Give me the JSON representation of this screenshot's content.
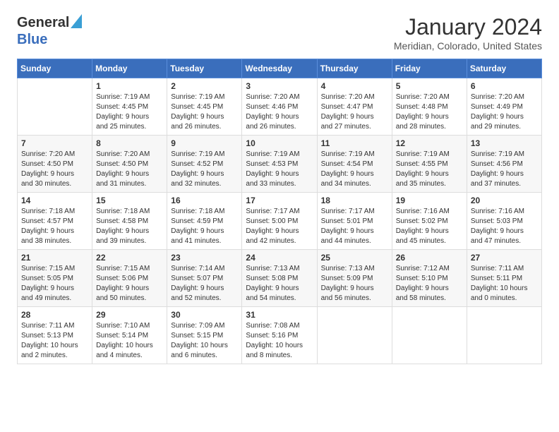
{
  "header": {
    "logo_general": "General",
    "logo_blue": "Blue",
    "title": "January 2024",
    "subtitle": "Meridian, Colorado, United States"
  },
  "days_of_week": [
    "Sunday",
    "Monday",
    "Tuesday",
    "Wednesday",
    "Thursday",
    "Friday",
    "Saturday"
  ],
  "weeks": [
    [
      {
        "day": "",
        "info": ""
      },
      {
        "day": "1",
        "info": "Sunrise: 7:19 AM\nSunset: 4:45 PM\nDaylight: 9 hours\nand 25 minutes."
      },
      {
        "day": "2",
        "info": "Sunrise: 7:19 AM\nSunset: 4:45 PM\nDaylight: 9 hours\nand 26 minutes."
      },
      {
        "day": "3",
        "info": "Sunrise: 7:20 AM\nSunset: 4:46 PM\nDaylight: 9 hours\nand 26 minutes."
      },
      {
        "day": "4",
        "info": "Sunrise: 7:20 AM\nSunset: 4:47 PM\nDaylight: 9 hours\nand 27 minutes."
      },
      {
        "day": "5",
        "info": "Sunrise: 7:20 AM\nSunset: 4:48 PM\nDaylight: 9 hours\nand 28 minutes."
      },
      {
        "day": "6",
        "info": "Sunrise: 7:20 AM\nSunset: 4:49 PM\nDaylight: 9 hours\nand 29 minutes."
      }
    ],
    [
      {
        "day": "7",
        "info": ""
      },
      {
        "day": "8",
        "info": "Sunrise: 7:20 AM\nSunset: 4:50 PM\nDaylight: 9 hours\nand 31 minutes."
      },
      {
        "day": "9",
        "info": "Sunrise: 7:19 AM\nSunset: 4:52 PM\nDaylight: 9 hours\nand 32 minutes."
      },
      {
        "day": "10",
        "info": "Sunrise: 7:19 AM\nSunset: 4:53 PM\nDaylight: 9 hours\nand 33 minutes."
      },
      {
        "day": "11",
        "info": "Sunrise: 7:19 AM\nSunset: 4:54 PM\nDaylight: 9 hours\nand 34 minutes."
      },
      {
        "day": "12",
        "info": "Sunrise: 7:19 AM\nSunset: 4:55 PM\nDaylight: 9 hours\nand 35 minutes."
      },
      {
        "day": "13",
        "info": "Sunrise: 7:19 AM\nSunset: 4:56 PM\nDaylight: 9 hours\nand 37 minutes."
      }
    ],
    [
      {
        "day": "14",
        "info": ""
      },
      {
        "day": "15",
        "info": "Sunrise: 7:18 AM\nSunset: 4:58 PM\nDaylight: 9 hours\nand 39 minutes."
      },
      {
        "day": "16",
        "info": "Sunrise: 7:18 AM\nSunset: 4:59 PM\nDaylight: 9 hours\nand 41 minutes."
      },
      {
        "day": "17",
        "info": "Sunrise: 7:17 AM\nSunset: 5:00 PM\nDaylight: 9 hours\nand 42 minutes."
      },
      {
        "day": "18",
        "info": "Sunrise: 7:17 AM\nSunset: 5:01 PM\nDaylight: 9 hours\nand 44 minutes."
      },
      {
        "day": "19",
        "info": "Sunrise: 7:16 AM\nSunset: 5:02 PM\nDaylight: 9 hours\nand 45 minutes."
      },
      {
        "day": "20",
        "info": "Sunrise: 7:16 AM\nSunset: 5:03 PM\nDaylight: 9 hours\nand 47 minutes."
      }
    ],
    [
      {
        "day": "21",
        "info": ""
      },
      {
        "day": "22",
        "info": "Sunrise: 7:15 AM\nSunset: 5:06 PM\nDaylight: 9 hours\nand 50 minutes."
      },
      {
        "day": "23",
        "info": "Sunrise: 7:14 AM\nSunset: 5:07 PM\nDaylight: 9 hours\nand 52 minutes."
      },
      {
        "day": "24",
        "info": "Sunrise: 7:13 AM\nSunset: 5:08 PM\nDaylight: 9 hours\nand 54 minutes."
      },
      {
        "day": "25",
        "info": "Sunrise: 7:13 AM\nSunset: 5:09 PM\nDaylight: 9 hours\nand 56 minutes."
      },
      {
        "day": "26",
        "info": "Sunrise: 7:12 AM\nSunset: 5:10 PM\nDaylight: 9 hours\nand 58 minutes."
      },
      {
        "day": "27",
        "info": "Sunrise: 7:11 AM\nSunset: 5:11 PM\nDaylight: 10 hours\nand 0 minutes."
      }
    ],
    [
      {
        "day": "28",
        "info": "Sunrise: 7:11 AM\nSunset: 5:13 PM\nDaylight: 10 hours\nand 2 minutes."
      },
      {
        "day": "29",
        "info": "Sunrise: 7:10 AM\nSunset: 5:14 PM\nDaylight: 10 hours\nand 4 minutes."
      },
      {
        "day": "30",
        "info": "Sunrise: 7:09 AM\nSunset: 5:15 PM\nDaylight: 10 hours\nand 6 minutes."
      },
      {
        "day": "31",
        "info": "Sunrise: 7:08 AM\nSunset: 5:16 PM\nDaylight: 10 hours\nand 8 minutes."
      },
      {
        "day": "",
        "info": ""
      },
      {
        "day": "",
        "info": ""
      },
      {
        "day": "",
        "info": ""
      }
    ]
  ],
  "week7_sunday_info": "Sunrise: 7:20 AM\nSunset: 4:50 PM\nDaylight: 9 hours\nand 30 minutes.",
  "week14_sunday_info": "Sunrise: 7:18 AM\nSunset: 4:57 PM\nDaylight: 9 hours\nand 38 minutes.",
  "week21_sunday_info": "Sunrise: 7:15 AM\nSunset: 5:05 PM\nDaylight: 9 hours\nand 49 minutes."
}
